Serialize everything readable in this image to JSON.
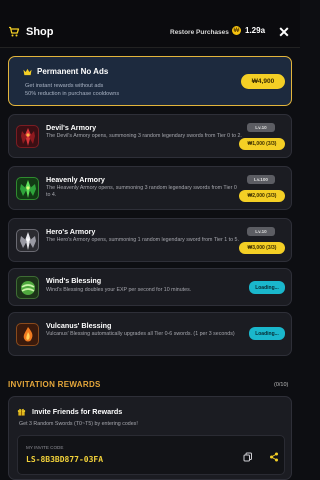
{
  "header": {
    "title": "Shop",
    "restore_label": "Restore Purchases",
    "balance": "1.29a",
    "close_label": "✕"
  },
  "no_ads": {
    "title": "Permanent No Ads",
    "desc_line1": "Get instant rewards without ads",
    "desc_line2": "50% reduction in purchase cooldowns",
    "price": "₩4,900"
  },
  "items": [
    {
      "name": "Devil's Armory",
      "desc": "The Devil's Armory opens, summoning 3 random legendary swords from Tier 0 to 2.",
      "level": "Lv.10",
      "price": "₩1,000 (3/3)",
      "icon": "devil-armory-icon"
    },
    {
      "name": "Heavenly Armory",
      "desc": "The Heavenly Armory opens, summoning 3 random legendary swords from Tier 0 to 4.",
      "level": "Lv.100",
      "price": "₩2,000 (3/3)",
      "icon": "heavenly-armory-icon"
    },
    {
      "name": "Hero's Armory",
      "desc": "The Hero's Armory opens, summoning 1 random legendary sword from Tier 1 to 5.",
      "level": "Lv.10",
      "price": "₩3,000 (3/3)",
      "icon": "hero-armory-icon"
    },
    {
      "name": "Wind's Blessing",
      "desc": "Wind's Blessing doubles your EXP per second for 10 minutes.",
      "status": "Loading...",
      "icon": "wind-blessing-icon"
    },
    {
      "name": "Vulcanus' Blessing",
      "desc": "Vulcanus' Blessing automatically upgrades all Tier 0-6 swords. (1 per 3 seconds)",
      "status": "Loading...",
      "icon": "vulcanus-blessing-icon"
    }
  ],
  "invitation": {
    "header": "INVITATION REWARDS",
    "count": "(0/10)",
    "title": "Invite Friends for Rewards",
    "desc": "Get 3 Random Swords (T0~T5) by entering codes!",
    "code_label": "MY INVITE CODE",
    "code": "LS-8B3BD877-03FA"
  },
  "colors": {
    "accent_gold": "#f4cf25",
    "loading_cyan": "#1ab7cc",
    "section_orange": "#e5a73b"
  }
}
